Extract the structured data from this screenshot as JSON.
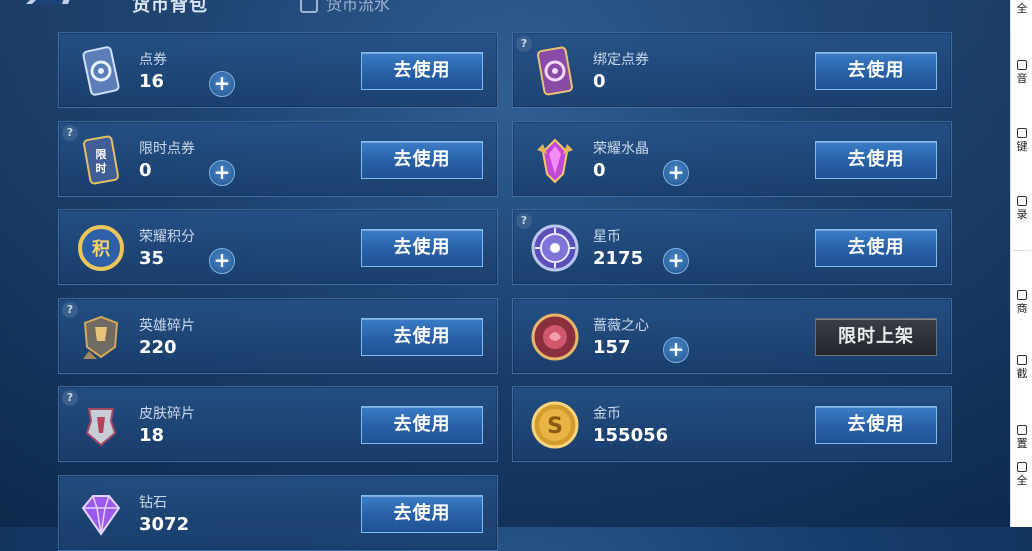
{
  "header": {
    "title": "货币背包",
    "flow_tab": "货币流水"
  },
  "cards": [
    {
      "name": "点券",
      "count": "16",
      "has_plus": true,
      "help": false,
      "button": "去使用",
      "button_type": "use",
      "icon": "coupon-icon"
    },
    {
      "name": "绑定点券",
      "count": "0",
      "has_plus": false,
      "help": true,
      "button": "去使用",
      "button_type": "use",
      "icon": "bound-coupon-icon"
    },
    {
      "name": "限时点券",
      "count": "0",
      "has_plus": true,
      "help": true,
      "button": "去使用",
      "button_type": "use",
      "icon": "limited-coupon-icon"
    },
    {
      "name": "荣耀水晶",
      "count": "0",
      "has_plus": true,
      "help": false,
      "button": "去使用",
      "button_type": "use",
      "icon": "glory-crystal-icon"
    },
    {
      "name": "荣耀积分",
      "count": "35",
      "has_plus": true,
      "help": false,
      "button": "去使用",
      "button_type": "use",
      "icon": "glory-points-icon"
    },
    {
      "name": "星币",
      "count": "2175",
      "has_plus": true,
      "help": true,
      "button": "去使用",
      "button_type": "use",
      "icon": "star-coin-icon"
    },
    {
      "name": "英雄碎片",
      "count": "220",
      "has_plus": false,
      "help": true,
      "button": "去使用",
      "button_type": "use",
      "icon": "hero-fragment-icon"
    },
    {
      "name": "蔷薇之心",
      "count": "157",
      "has_plus": true,
      "help": false,
      "button": "限时上架",
      "button_type": "limited",
      "icon": "rose-heart-icon"
    },
    {
      "name": "皮肤碎片",
      "count": "18",
      "has_plus": false,
      "help": true,
      "button": "去使用",
      "button_type": "use",
      "icon": "skin-fragment-icon"
    },
    {
      "name": "金币",
      "count": "155056",
      "has_plus": false,
      "help": false,
      "button": "去使用",
      "button_type": "use",
      "icon": "gold-coin-icon"
    },
    {
      "name": "钻石",
      "count": "3072",
      "has_plus": false,
      "help": false,
      "button": "去使用",
      "button_type": "use",
      "icon": "diamond-icon"
    }
  ],
  "help_glyph": "?",
  "plus_glyph": "+",
  "side_panel": {
    "items": [
      {
        "label": "全",
        "icon": "fullscreen-icon"
      },
      {
        "label": "音",
        "icon": "volume-icon"
      },
      {
        "label": "键",
        "icon": "keyboard-icon"
      },
      {
        "label": "录",
        "icon": "record-icon"
      },
      {
        "label": "商",
        "icon": "store-icon"
      },
      {
        "label": "截",
        "icon": "screenshot-icon"
      },
      {
        "label": "置",
        "icon": "pin-icon"
      },
      {
        "label": "全",
        "icon": "grid-icon"
      }
    ]
  },
  "colors": {
    "background": "#173e6e",
    "use_button": "#2860a6",
    "limited_button": "#2a2e34",
    "count_text": "#ffffff"
  }
}
